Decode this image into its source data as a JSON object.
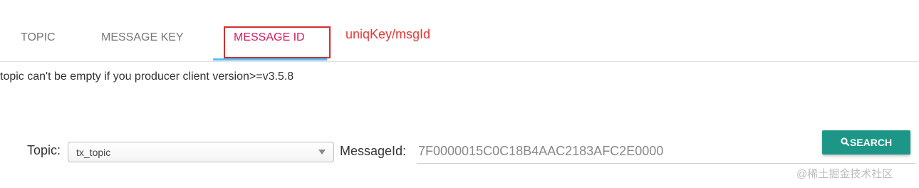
{
  "tabs": [
    {
      "label": "TOPIC",
      "active": false
    },
    {
      "label": "MESSAGE KEY",
      "active": false
    },
    {
      "label": "MESSAGE ID",
      "active": true
    }
  ],
  "annotation": "uniqKey/msgId",
  "notice": "topic can't be empty if you producer client version>=v3.5.8",
  "form": {
    "topic_label": "Topic:",
    "topic_value": "tx_topic",
    "messageid_label": "MessageId:",
    "messageid_value": "7F0000015C0C18B4AAC2183AFC2E0000",
    "search_label": "SEARCH",
    "search_icon": "search-icon"
  },
  "watermark": "@稀土掘金技术社区",
  "colors": {
    "active_tab": "#d81b60",
    "ink_bar": "#4fc3f7",
    "highlight_box": "#d32f2f",
    "annotation": "#e53935",
    "search_button": "#1e9687"
  }
}
